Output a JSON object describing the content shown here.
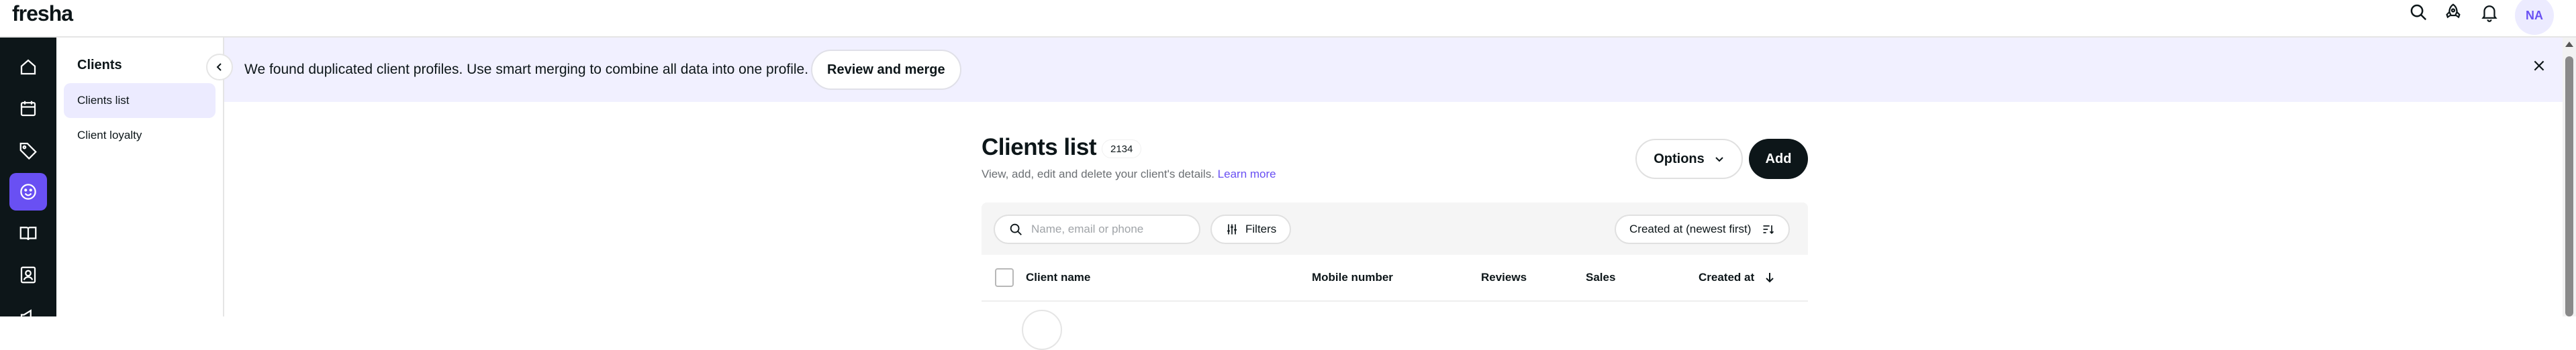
{
  "app": {
    "logo": "fresha",
    "user_initials": "NA"
  },
  "topbar": {
    "icons": [
      "search-icon",
      "rocket-icon",
      "bell-icon"
    ]
  },
  "rail": {
    "items": [
      "home-icon",
      "calendar-icon",
      "tag-icon",
      "smiley-icon",
      "book-icon",
      "contact-card-icon",
      "megaphone-icon"
    ],
    "active": "smiley-icon"
  },
  "subnav": {
    "title": "Clients",
    "items": [
      {
        "label": "Clients list",
        "active": true
      },
      {
        "label": "Client loyalty",
        "active": false
      }
    ]
  },
  "banner": {
    "text": "We found duplicated client profiles. Use smart merging to combine all data into one profile.",
    "button_label": "Review and merge"
  },
  "main": {
    "title": "Clients list",
    "count": "2134",
    "subtitle": "View, add, edit and delete your client's details.",
    "learn_more": "Learn more",
    "options_label": "Options",
    "add_label": "Add"
  },
  "filters": {
    "search_placeholder": "Name, email or phone",
    "filters_label": "Filters",
    "sort_label": "Created at (newest first)"
  },
  "table": {
    "columns": [
      "Client name",
      "Mobile number",
      "Reviews",
      "Sales",
      "Created at"
    ]
  },
  "colors": {
    "accent": "#6950f3",
    "banner_bg": "#f1f0ff",
    "rail_bg": "#0d1619"
  }
}
